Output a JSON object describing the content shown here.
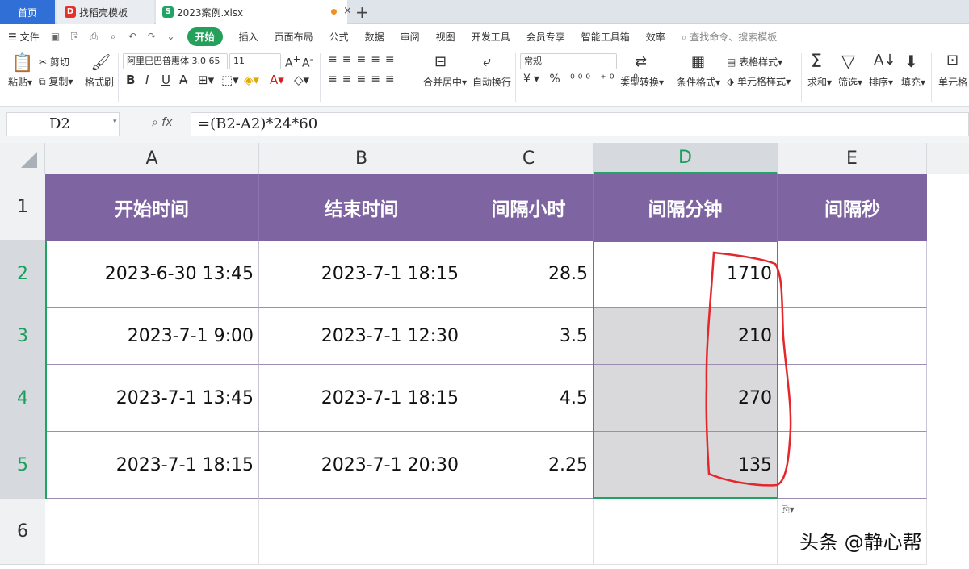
{
  "tabs": {
    "home": "首页",
    "template": "找稻壳模板",
    "file": "2023案例.xlsx"
  },
  "menu": {
    "file": "文件",
    "items": [
      "开始",
      "插入",
      "页面布局",
      "公式",
      "数据",
      "审阅",
      "视图",
      "开发工具",
      "会员专享",
      "智能工具箱",
      "效率"
    ],
    "search": "查找命令、搜索模板"
  },
  "ribbon": {
    "paste": "粘贴",
    "cut": "剪切",
    "copy": "复制",
    "format_painter": "格式刷",
    "font_name": "阿里巴巴普惠体 3.0 65",
    "font_size": "11",
    "merge_center": "合并居中",
    "wrap_text": "自动换行",
    "number_format": "常规",
    "type_convert": "类型转换",
    "cond_format": "条件格式",
    "table_style": "表格样式",
    "cell_style": "单元格样式",
    "sum": "求和",
    "filter": "筛选",
    "sort": "排序",
    "fill": "填充",
    "cell": "单元格",
    "bold": "B",
    "italic": "I",
    "underline": "U"
  },
  "formula_bar": {
    "name_box": "D2",
    "fx": "fx",
    "formula": "=(B2-A2)*24*60"
  },
  "sheet": {
    "columns": [
      "A",
      "B",
      "C",
      "D",
      "E"
    ],
    "rows": [
      "1",
      "2",
      "3",
      "4",
      "5",
      "6"
    ],
    "headers": [
      "开始时间",
      "结束时间",
      "间隔小时",
      "间隔分钟",
      "间隔秒"
    ],
    "data": [
      [
        "2023-6-30 13:45",
        "2023-7-1 18:15",
        "28.5",
        "1710",
        ""
      ],
      [
        "2023-7-1 9:00",
        "2023-7-1 12:30",
        "3.5",
        "210",
        ""
      ],
      [
        "2023-7-1 13:45",
        "2023-7-1 18:15",
        "4.5",
        "270",
        ""
      ],
      [
        "2023-7-1 18:15",
        "2023-7-1 20:30",
        "2.25",
        "135",
        ""
      ]
    ]
  },
  "watermark": "头条 @静心帮",
  "colors": {
    "header_fill": "#7e64a1",
    "selection": "#1fa463",
    "annotation": "#e5262b",
    "home_tab": "#2f6fd6"
  }
}
